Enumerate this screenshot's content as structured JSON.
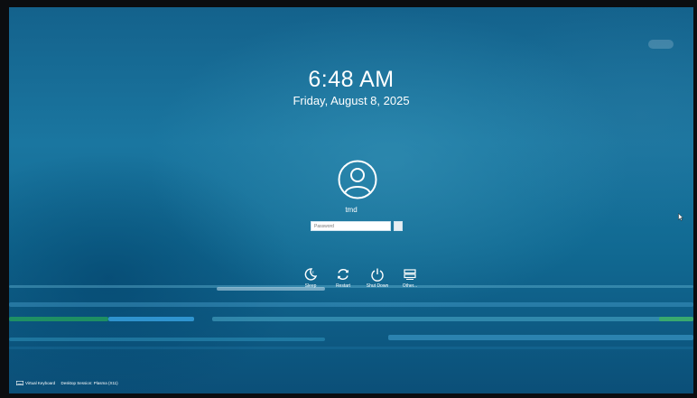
{
  "lockscreen": {
    "time": "6:48 AM",
    "date": "Friday, August 8, 2025",
    "user": {
      "name": "tmd",
      "avatar_icon": "user-avatar-icon"
    },
    "password_placeholder": "Password",
    "login_icon": "arrow-right-icon"
  },
  "actions": [
    {
      "label": "Sleep",
      "icon": "sleep-icon"
    },
    {
      "label": "Restart",
      "icon": "restart-icon"
    },
    {
      "label": "Shut Down",
      "icon": "power-icon"
    },
    {
      "label": "Other...",
      "icon": "switch-user-icon"
    }
  ],
  "bottom_bar": {
    "virtual_keyboard": "Virtual Keyboard",
    "session": "Desktop Session: Plasma (X11)"
  },
  "colors": {
    "background": "#1a76a0",
    "text": "#ffffff"
  }
}
